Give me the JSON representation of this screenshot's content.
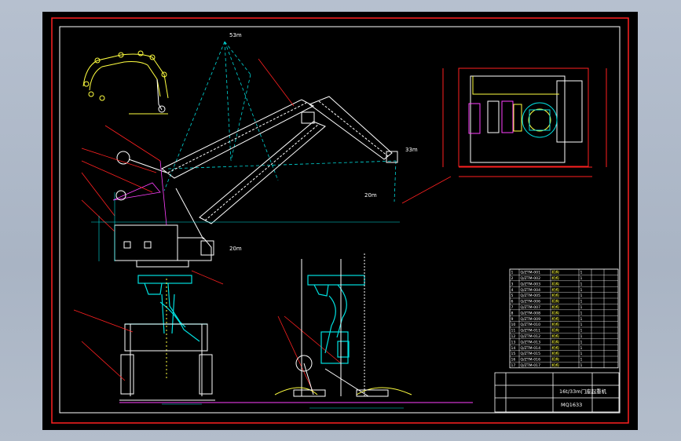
{
  "drawing": {
    "elevation_labels": {
      "top": "53m",
      "tip": "33m",
      "hook_end": "20m",
      "pivot": "20m"
    },
    "parts_table": {
      "rows": [
        [
          "1",
          "Q/ZTM-001",
          "机构",
          "1",
          "",
          ""
        ],
        [
          "2",
          "Q/ZTM-002",
          "机构",
          "1",
          "",
          ""
        ],
        [
          "3",
          "Q/ZTM-003",
          "机构",
          "1",
          "",
          ""
        ],
        [
          "4",
          "Q/ZTM-004",
          "机构",
          "1",
          "",
          ""
        ],
        [
          "5",
          "Q/ZTM-005",
          "机构",
          "1",
          "",
          ""
        ],
        [
          "6",
          "Q/ZTM-006",
          "机构",
          "1",
          "",
          ""
        ],
        [
          "7",
          "Q/ZTM-007",
          "机构",
          "1",
          "",
          ""
        ],
        [
          "8",
          "Q/ZTM-008",
          "机构",
          "1",
          "",
          ""
        ],
        [
          "9",
          "Q/ZTM-009",
          "机构",
          "1",
          "",
          ""
        ],
        [
          "10",
          "Q/ZTM-010",
          "机构",
          "1",
          "",
          ""
        ],
        [
          "11",
          "Q/ZTM-011",
          "机构",
          "1",
          "",
          ""
        ],
        [
          "12",
          "Q/ZTM-012",
          "机构",
          "1",
          "",
          ""
        ],
        [
          "13",
          "Q/ZTM-013",
          "机构",
          "1",
          "",
          ""
        ],
        [
          "14",
          "Q/ZTM-014",
          "机构",
          "1",
          "",
          ""
        ],
        [
          "15",
          "Q/ZTM-015",
          "机构",
          "1",
          "",
          ""
        ],
        [
          "16",
          "Q/ZTM-016",
          "机构",
          "1",
          "",
          ""
        ],
        [
          "17",
          "Q/ZTM-017",
          "机构",
          "1",
          "",
          ""
        ]
      ]
    },
    "title_block": {
      "title": "16t/33m门座起重机",
      "drawing_no": "MQ1633"
    },
    "colors": {
      "frame": "#ff2020",
      "steel": "#ffffff",
      "cyan": "#00e0e0",
      "yellow": "#e8e820",
      "magenta": "#ff40ff"
    }
  }
}
